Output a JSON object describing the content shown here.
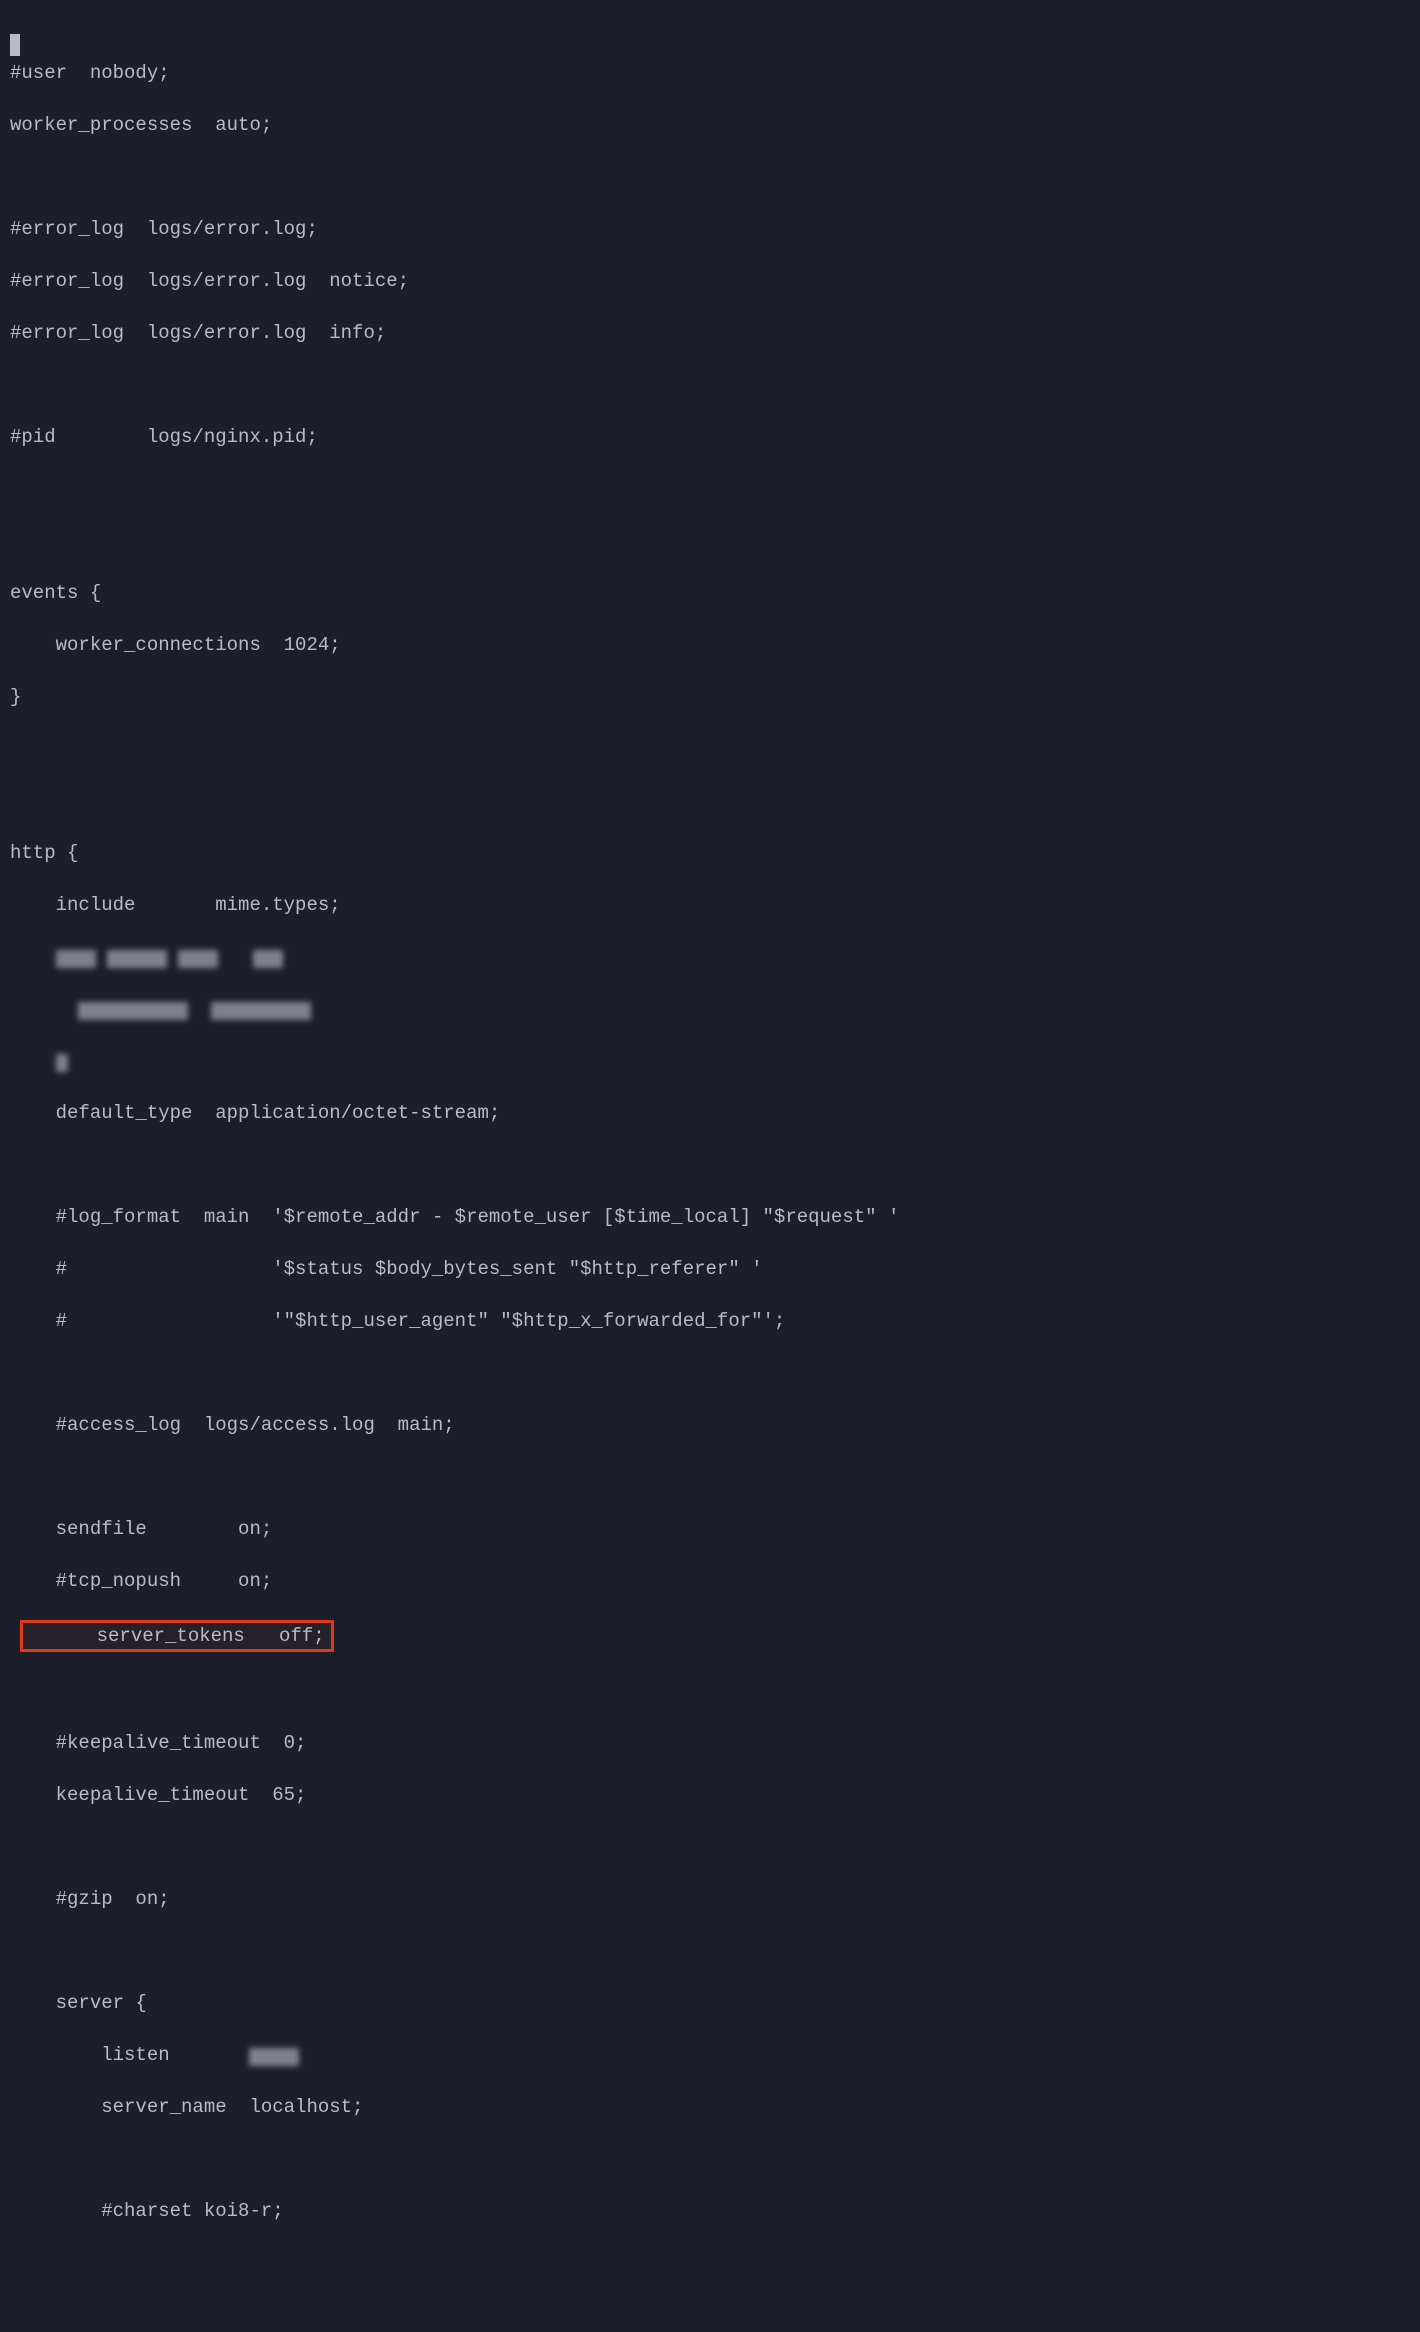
{
  "lines": {
    "l1": "#user  nobody;",
    "l2": "worker_processes  auto;",
    "l3": "#error_log  logs/error.log;",
    "l4": "#error_log  logs/error.log  notice;",
    "l5": "#error_log  logs/error.log  info;",
    "l6": "#pid        logs/nginx.pid;",
    "l7": "events {",
    "l8": "    worker_connections  1024;",
    "l9": "}",
    "l10": "http {",
    "l11": "    include       mime.types;",
    "l12": "    default_type  application/octet-stream;",
    "l13": "    #log_format  main  '$remote_addr - $remote_user [$time_local] \"$request\" '",
    "l14": "    #                  '$status $body_bytes_sent \"$http_referer\" '",
    "l15": "    #                  '\"$http_user_agent\" \"$http_x_forwarded_for\"';",
    "l16": "    #access_log  logs/access.log  main;",
    "l17": "    sendfile        on;",
    "l18": "    #tcp_nopush     on;",
    "l19": "    server_tokens   off;",
    "l20": "    #keepalive_timeout  0;",
    "l21": "    keepalive_timeout  65;",
    "l22": "    #gzip  on;",
    "l23": "    server {",
    "l24": "        listen       ",
    "l25": "        server_name  localhost;",
    "l26": "        #charset koi8-r;"
  },
  "colors": {
    "highlight_border": "#e13a1b",
    "background": "#1c1f2b",
    "text": "#b9bcc4"
  }
}
